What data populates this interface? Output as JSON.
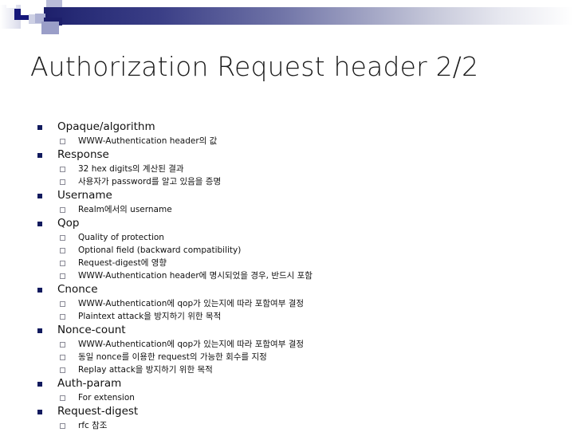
{
  "slide": {
    "title": "Authorization Request header 2/2",
    "header_decoration": {
      "accent_dark": "#1d1f6b",
      "accent_mid": "#9fa3cb",
      "accent_light": "#cdd0e4"
    },
    "bullet_colors": {
      "level1_marker": "#111a5e",
      "level2_marker": "#8a8a96"
    },
    "outline": [
      {
        "label": "Opaque/algorithm",
        "children": [
          "WWW-Authentication header의 값"
        ]
      },
      {
        "label": "Response",
        "children": [
          "32 hex digits의 계산된 결과",
          "사용자가 password를 알고 있음을 증명"
        ]
      },
      {
        "label": "Username",
        "children": [
          "Realm에서의 username"
        ]
      },
      {
        "label": "Qop",
        "children": [
          "Quality of protection",
          "Optional field (backward compatibility)",
          "Request-digest에 영향",
          "WWW-Authentication header에 명시되었을 경우, 반드시 포함"
        ]
      },
      {
        "label": "Cnonce",
        "children": [
          "WWW-Authentication에 qop가 있는지에 따라 포함여부 결정",
          "Plaintext attack을 방지하기 위한 목적"
        ]
      },
      {
        "label": "Nonce-count",
        "children": [
          "WWW-Authentication에 qop가 있는지에 따라 포함여부 결정",
          "동일 nonce를 이용한 request의 가능한 회수를 지정",
          "Replay attack을 방지하기 위한 목적"
        ]
      },
      {
        "label": "Auth-param",
        "children": [
          "For extension"
        ]
      },
      {
        "label": "Request-digest",
        "children": [
          "rfc 참조"
        ]
      }
    ]
  }
}
